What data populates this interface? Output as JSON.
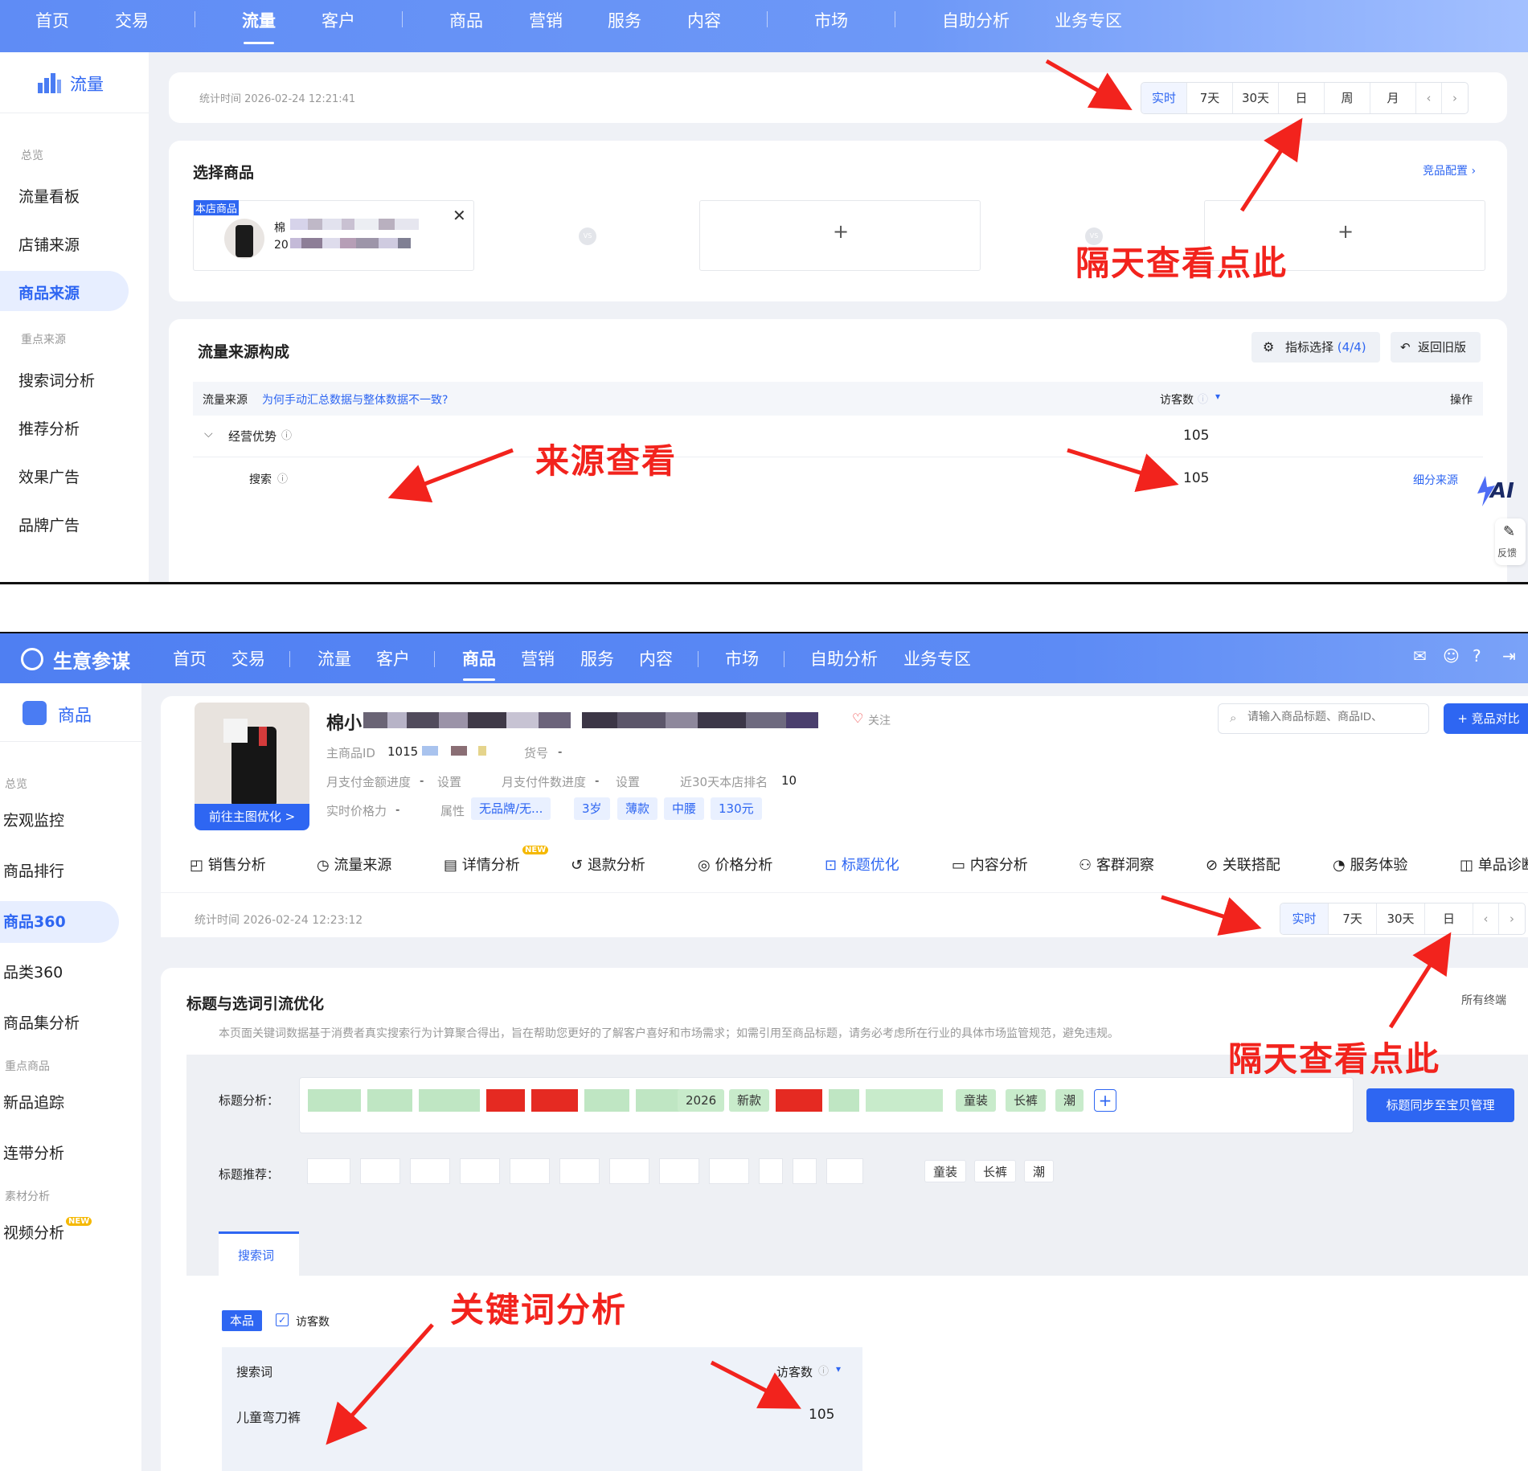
{
  "p1": {
    "nav": [
      "首页",
      "交易",
      "流量",
      "客户",
      "商品",
      "营销",
      "服务",
      "内容",
      "市场",
      "自助分析",
      "业务专区"
    ],
    "sidebar": {
      "title": "流量",
      "section1": "总览",
      "items1": [
        "流量看板",
        "店铺来源",
        "商品来源"
      ],
      "section2": "重点来源",
      "items2": [
        "搜索词分析",
        "推荐分析",
        "效果广告",
        "品牌广告"
      ]
    },
    "stat_time": "统计时间 2026-02-24 12:21:41",
    "time_tabs": [
      "实时",
      "7天",
      "30天",
      "日",
      "周",
      "月"
    ],
    "select_title": "选择商品",
    "config_link": "竞品配置 ›",
    "own_label": "本店商品",
    "product_line1": "棉",
    "product_line2": "20",
    "vs": "VS",
    "plus": "+",
    "flow_title": "流量来源构成",
    "metric_btn": "指标选择",
    "metric_count": "(4/4)",
    "old_btn": "返回旧版",
    "table": {
      "col_source": "流量来源",
      "col_hint": "为何手动汇总数据与整体数据不一致?",
      "col_visitors": "访客数",
      "col_op": "操作",
      "row1_name": "经营优势",
      "row1_val": "105",
      "row2_name": "搜索",
      "row2_val": "105",
      "row2_op": "细分来源"
    },
    "ai": "AI",
    "feedback": "反馈",
    "ann_daily": "隔天查看点此",
    "ann_source": "来源查看"
  },
  "p2": {
    "brand": "生意参谋",
    "nav": [
      "首页",
      "交易",
      "流量",
      "客户",
      "商品",
      "营销",
      "服务",
      "内容",
      "市场",
      "自助分析",
      "业务专区"
    ],
    "sidebar": {
      "title": "商品",
      "section1": "总览",
      "items1": [
        "宏观监控",
        "商品排行",
        "商品360",
        "品类360",
        "商品集分析"
      ],
      "section2": "重点商品",
      "items2": [
        "新品追踪",
        "连带分析"
      ],
      "section3": "素材分析",
      "items3": [
        "视频分析"
      ],
      "new_badge": "NEW"
    },
    "product": {
      "title_start": "棉小",
      "follow": "关注",
      "main_id_label": "主商品ID",
      "main_id": "1015",
      "sku_label": "货号",
      "sku": "-",
      "pay_amount_label": "月支付金额进度",
      "pay_amount": "-",
      "set": "设置",
      "pay_count_label": "月支付件数进度",
      "pay_count": "-",
      "rank_label": "近30天本店排名",
      "rank": "10",
      "price_label": "实时价格力",
      "price": "-",
      "attr_label": "属性",
      "attrs": [
        "无品牌/无...",
        "3岁",
        "薄款",
        "中腰",
        "130元"
      ],
      "goto_btn": "前往主图优化 >"
    },
    "search_placeholder": "请输入商品标题、商品ID、",
    "compare_btn": "+ 竞品对比",
    "tabs": [
      "销售分析",
      "流量来源",
      "详情分析",
      "退款分析",
      "价格分析",
      "标题优化",
      "内容分析",
      "客群洞察",
      "关联搭配",
      "服务体验",
      "单品诊断"
    ],
    "tab_new": "NEW",
    "stat_time": "统计时间 2026-02-24 12:23:12",
    "time_tabs": [
      "实时",
      "7天",
      "30天",
      "日"
    ],
    "section_title": "标题与选词引流优化",
    "all_terminals": "所有终端",
    "notice": "本页面关键词数据基于消费者真实搜索行为计算聚合得出，旨在帮助您更好的了解客户喜好和市场需求；如需引用至商品标题，请务必考虑所在行业的具体市场监管规范，避免违规。",
    "title_analysis_label": "标题分析：",
    "title_words": [
      "2026",
      "新款",
      "童装",
      "长裤",
      "潮"
    ],
    "sync_btn": "标题同步至宝贝管理",
    "title_reco_label": "标题推荐：",
    "reco_words": [
      "童装",
      "长裤",
      "潮"
    ],
    "search_tab": "搜索词",
    "own_tag": "本品",
    "visitors_check": "访客数",
    "kw_table": {
      "col_kw": "搜索词",
      "col_visitors": "访客数",
      "row_kw": "儿童弯刀裤",
      "row_val": "105"
    },
    "ann_daily": "隔天查看点此",
    "ann_kw": "关键词分析"
  },
  "colors": {
    "accent": "#2e66f2",
    "annotation": "#f2231d",
    "nav_gradient_start": "#5f8cf5"
  }
}
